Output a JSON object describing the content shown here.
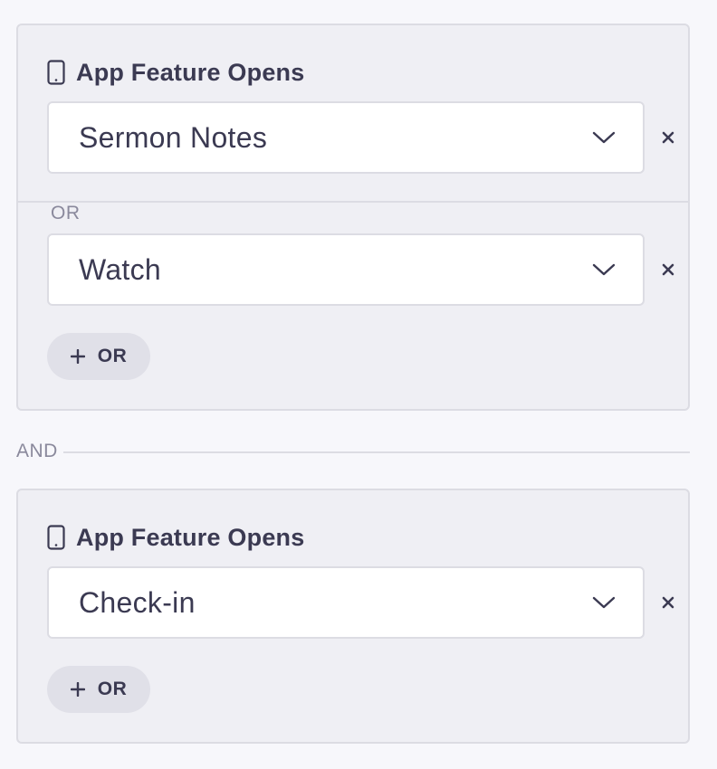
{
  "groups": [
    {
      "title": "App Feature Opens",
      "icon": "phone-icon",
      "conditions": [
        {
          "value": "Sermon Notes"
        },
        {
          "value": "Watch"
        }
      ],
      "or_separator": "OR",
      "add_or_label": "OR"
    },
    {
      "title": "App Feature Opens",
      "icon": "phone-icon",
      "conditions": [
        {
          "value": "Check-in"
        }
      ],
      "add_or_label": "OR"
    }
  ],
  "and_separator": "AND",
  "colors": {
    "page_bg": "#f7f7fb",
    "group_bg": "#efeff4",
    "border": "#dcdce3",
    "text": "#3b3a52",
    "muted": "#8a899c",
    "pill_bg": "#e0e0e8"
  }
}
